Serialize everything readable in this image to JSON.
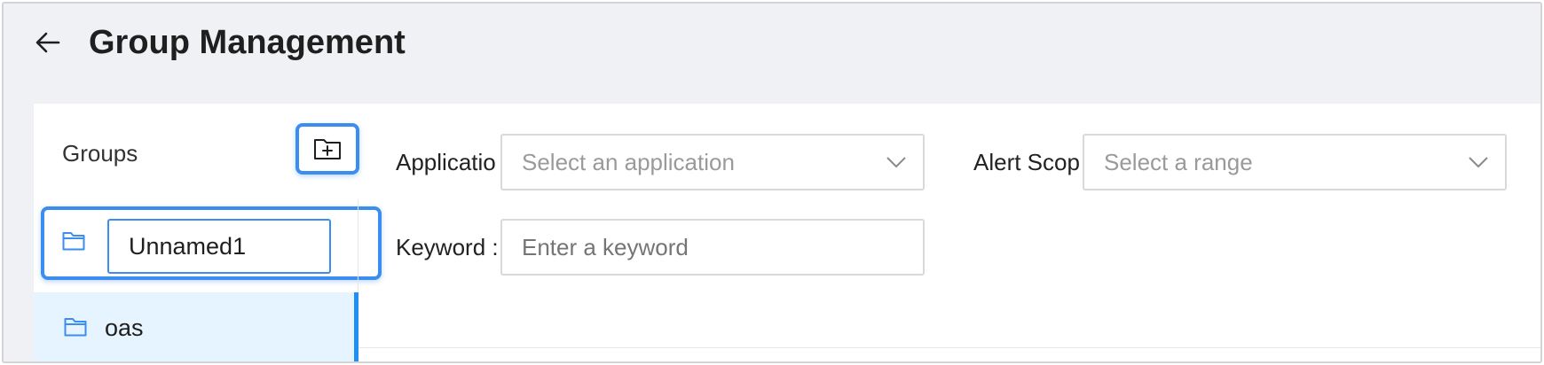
{
  "header": {
    "back_icon": "arrow-left-icon",
    "title": "Group Management"
  },
  "sidebar": {
    "title": "Groups",
    "add_folder_icon": "folder-plus-icon",
    "editing_item": {
      "icon": "folder-icon",
      "value": "Unnamed1"
    },
    "items": [
      {
        "label": "oas",
        "icon": "folder-icon",
        "selected": true
      }
    ]
  },
  "filters": {
    "application": {
      "label": "Applicatio",
      "placeholder": "Select an application",
      "icon": "chevron-down-icon"
    },
    "alert_scope": {
      "label": "Alert Scop",
      "placeholder": "Select a range",
      "icon": "chevron-down-icon"
    },
    "keyword": {
      "label": "Keyword :",
      "placeholder": "Enter a keyword"
    }
  },
  "colors": {
    "accent": "#3b8df0",
    "selected_bg": "#e5f4fe",
    "selected_bar": "#1f8ff5",
    "page_bg": "#f0f1f4"
  }
}
